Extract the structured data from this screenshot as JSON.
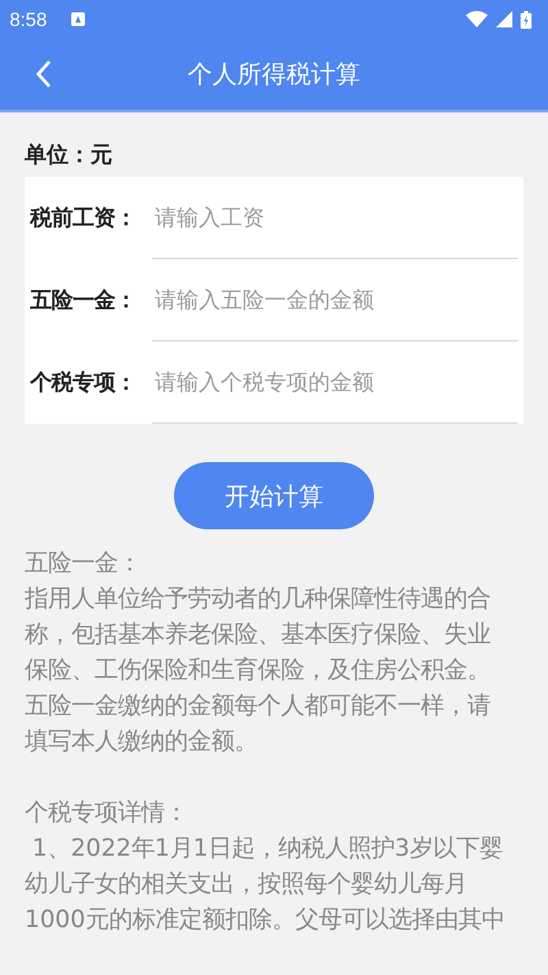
{
  "status_bar": {
    "time": "8:58"
  },
  "app_bar": {
    "title": "个人所得税计算"
  },
  "unit_label": "单位：元",
  "form": {
    "fields": [
      {
        "label": "税前工资：",
        "placeholder": "请输入工资"
      },
      {
        "label": "五险一金：",
        "placeholder": "请输入五险一金的金额"
      },
      {
        "label": "个税专项：",
        "placeholder": "请输入个税专项的金额"
      }
    ]
  },
  "button": "开始计算",
  "notes": [
    {
      "title": "五险一金：",
      "body": "指用人单位给予劳动者的几种保障性待遇的合称，包括基本养老保险、基本医疗保险、失业保险、工伤保险和生育保险，及住房公积金。五险一金缴纳的金额每个人都可能不一样，请填写本人缴纳的金额。"
    },
    {
      "title": "个税专项详情：",
      "body": " 1、2022年1月1日起，纳税人照护3岁以下婴幼儿子女的相关支出，按照每个婴幼儿每月1000元的标准定额扣除。父母可以选择由其中"
    }
  ]
}
